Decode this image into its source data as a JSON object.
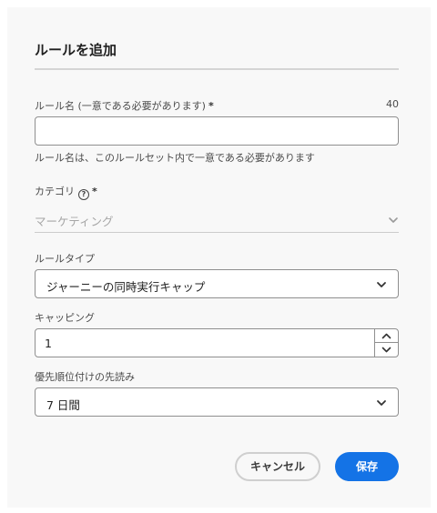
{
  "dialog": {
    "title": "ルールを追加",
    "rule_name": {
      "label": "ルール名 (一意である必要があります)",
      "required_mark": "*",
      "counter": "40",
      "value": "",
      "help": "ルール名は、このルールセット内で一意である必要があります"
    },
    "category": {
      "label": "カテゴリ",
      "info_icon": "?",
      "required_mark": "*",
      "value": "マーケティング"
    },
    "rule_type": {
      "label": "ルールタイプ",
      "value": "ジャーニーの同時実行キャップ"
    },
    "capping": {
      "label": "キャッピング",
      "value": "1"
    },
    "priority_lookahead": {
      "label": "優先順位付けの先読み",
      "value": "7 日間"
    },
    "buttons": {
      "cancel": "キャンセル",
      "save": "保存"
    },
    "colors": {
      "accent": "#1473e6",
      "background": "#f8f8f8"
    },
    "icons": [
      "info-icon",
      "chevron-down-icon",
      "stepper-up-icon",
      "stepper-down-icon"
    ]
  }
}
